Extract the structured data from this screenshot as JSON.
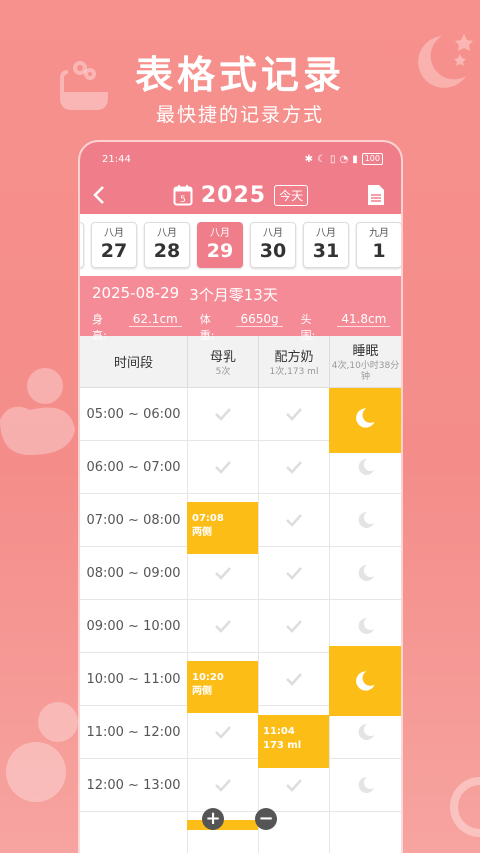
{
  "promo": {
    "title": "表格式记录",
    "subtitle": "最快捷的记录方式"
  },
  "status_bar": {
    "time": "21:44",
    "battery": "100"
  },
  "app_bar": {
    "year": "2025",
    "today_label": "今天",
    "calendar_icon_day": "5"
  },
  "date_strip": [
    {
      "month": "八月",
      "day": "27",
      "selected": false
    },
    {
      "month": "八月",
      "day": "28",
      "selected": false
    },
    {
      "month": "八月",
      "day": "29",
      "selected": true
    },
    {
      "month": "八月",
      "day": "30",
      "selected": false
    },
    {
      "month": "八月",
      "day": "31",
      "selected": false
    },
    {
      "month": "九月",
      "day": "1",
      "selected": false
    }
  ],
  "baby_info": {
    "date": "2025-08-29",
    "age": "3个月零13天",
    "height_label": "身高:",
    "height_value": "62.1cm",
    "weight_label": "体重:",
    "weight_value": "6650g",
    "head_label": "头围:",
    "head_value": "41.8cm"
  },
  "table": {
    "headers": [
      {
        "title": "时间段",
        "sub": ""
      },
      {
        "title": "母乳",
        "sub": "5次"
      },
      {
        "title": "配方奶",
        "sub": "1次,173 ml"
      },
      {
        "title": "睡眠",
        "sub": "4次,10小时38分钟"
      }
    ],
    "rows": [
      {
        "time": "05:00 ~ 06:00"
      },
      {
        "time": "06:00 ~ 07:00"
      },
      {
        "time": "07:00 ~ 08:00"
      },
      {
        "time": "08:00 ~ 09:00"
      },
      {
        "time": "09:00 ~ 10:00"
      },
      {
        "time": "10:00 ~ 11:00"
      },
      {
        "time": "11:00 ~ 12:00"
      },
      {
        "time": "12:00 ~ 13:00"
      }
    ],
    "entries": {
      "breastfeed_1_time": "07:08",
      "breastfeed_1_side": "两侧",
      "breastfeed_2_time": "10:20",
      "breastfeed_2_side": "两侧",
      "formula_1_time": "11:04",
      "formula_1_amount": "173 ml"
    }
  },
  "fab": {
    "add": "+",
    "remove": "−"
  },
  "colors": {
    "background": "#f48d8a",
    "header_pink": "#f07e8a",
    "info_pink": "#f58b97",
    "entry_yellow": "#fbbd16"
  }
}
